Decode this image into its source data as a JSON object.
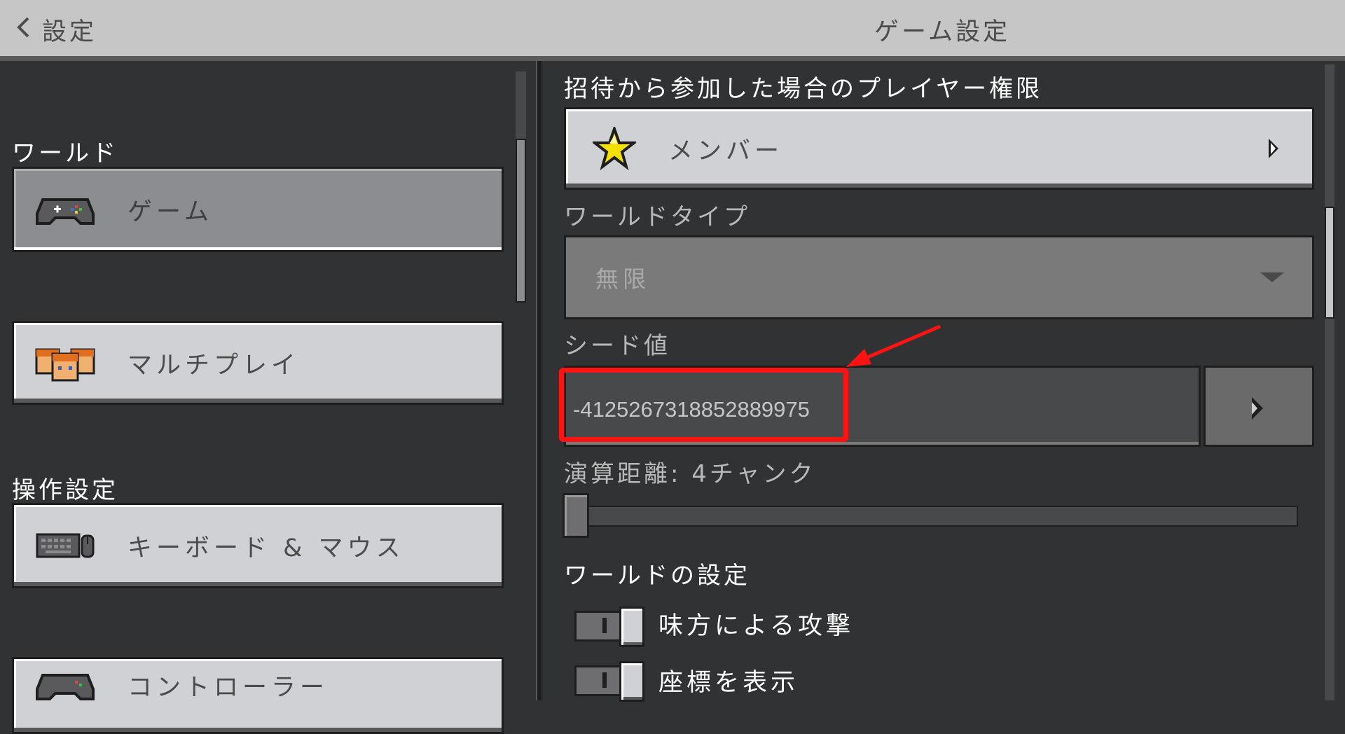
{
  "header": {
    "back_label": "設定",
    "title": "ゲーム設定"
  },
  "sidebar": {
    "sections": [
      {
        "label": "ワールド"
      },
      {
        "label": "操作設定"
      }
    ],
    "items": [
      {
        "label": "ゲーム",
        "icon": "gamepad-icon",
        "selected": true
      },
      {
        "label": "マルチプレイ",
        "icon": "players-icon",
        "selected": false
      },
      {
        "label": "キーボード & マウス",
        "icon": "keyboard-mouse-icon",
        "selected": false
      },
      {
        "label": "コントローラー",
        "icon": "controller-icon",
        "selected": false
      }
    ]
  },
  "settings": {
    "invite_permission": {
      "label": "招待から参加した場合のプレイヤー権限",
      "value": "メンバー",
      "icon": "star-icon"
    },
    "world_type": {
      "label": "ワールドタイプ",
      "value": "無限",
      "disabled": true
    },
    "seed": {
      "label": "シード値",
      "value": "-4125267318852889975"
    },
    "simulation_distance": {
      "label": "演算距離: 4チャンク",
      "slider_position": 0.0
    },
    "world_options": {
      "label": "ワールドの設定",
      "toggles": [
        {
          "label": "味方による攻撃",
          "on": true
        },
        {
          "label": "座標を表示",
          "on": true
        }
      ]
    }
  },
  "annotation": {
    "color": "#ff1212"
  },
  "colors": {
    "background": "#313233",
    "header": "#c6c6c6",
    "button_light": "#d0d1d4",
    "button_selected": "#8c8d90",
    "annotation_red": "#ff1212"
  }
}
